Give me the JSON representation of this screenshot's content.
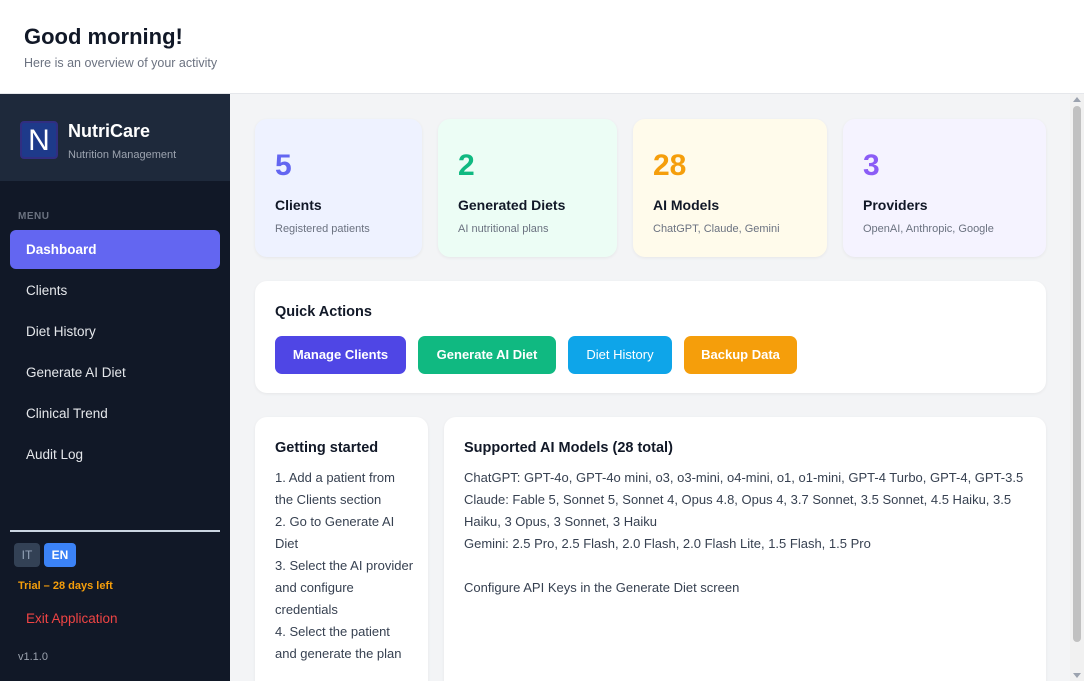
{
  "header": {
    "greeting": "Good morning!",
    "subtitle": "Here is an overview of your activity"
  },
  "sidebar": {
    "logo_letter": "N",
    "app_name": "NutriCare",
    "tagline": "Nutrition Management",
    "menu_label": "MENU",
    "items": [
      {
        "label": "Dashboard",
        "active": true
      },
      {
        "label": "Clients",
        "active": false
      },
      {
        "label": "Diet History",
        "active": false
      },
      {
        "label": "Generate AI Diet",
        "active": false
      },
      {
        "label": "Clinical Trend",
        "active": false
      },
      {
        "label": "Audit Log",
        "active": false
      }
    ],
    "languages": [
      "IT",
      "EN"
    ],
    "selected_language": "EN",
    "trial": "Trial – 28 days left",
    "exit": "Exit Application",
    "version": "v1.1.0"
  },
  "stats": [
    {
      "value": "5",
      "title": "Clients",
      "desc": "Registered patients",
      "color": "#6366f1",
      "bg": "#eef2ff"
    },
    {
      "value": "2",
      "title": "Generated Diets",
      "desc": "AI nutritional plans",
      "color": "#10b981",
      "bg": "#ecfdf5"
    },
    {
      "value": "28",
      "title": "AI Models",
      "desc": "ChatGPT, Claude, Gemini",
      "color": "#f59e0b",
      "bg": "#fffbeb"
    },
    {
      "value": "3",
      "title": "Providers",
      "desc": "OpenAI, Anthropic, Google",
      "color": "#8b5cf6",
      "bg": "#f5f3ff"
    }
  ],
  "quick_actions": {
    "title": "Quick Actions",
    "buttons": [
      {
        "label": "Manage Clients",
        "color": "#4f46e5"
      },
      {
        "label": "Generate AI Diet",
        "color": "#10b981"
      },
      {
        "label": "Diet History",
        "color": "#0ea5e9"
      },
      {
        "label": "Backup Data",
        "color": "#f59e0b"
      }
    ]
  },
  "getting_started": {
    "title": "Getting started",
    "steps": [
      "1. Add a patient from the Clients section",
      "2. Go to Generate AI Diet",
      "3. Select the AI provider and configure credentials",
      "4. Select the patient and generate the plan"
    ]
  },
  "supported_models": {
    "title": "Supported AI Models (28 total)",
    "chatgpt": "ChatGPT: GPT-4o, GPT-4o mini, o3, o3-mini, o4-mini, o1, o1-mini, GPT-4 Turbo, GPT-4, GPT-3.5",
    "claude": "Claude: Fable 5, Sonnet 5, Sonnet 4, Opus 4.8, Opus 4, 3.7 Sonnet, 3.5 Sonnet, 4.5 Haiku, 3.5 Haiku, 3 Opus, 3 Sonnet, 3 Haiku",
    "gemini": "Gemini: 2.5 Pro, 2.5 Flash, 2.0 Flash, 2.0 Flash Lite, 1.5 Flash, 1.5 Pro",
    "note": "Configure API Keys in the Generate Diet screen"
  }
}
